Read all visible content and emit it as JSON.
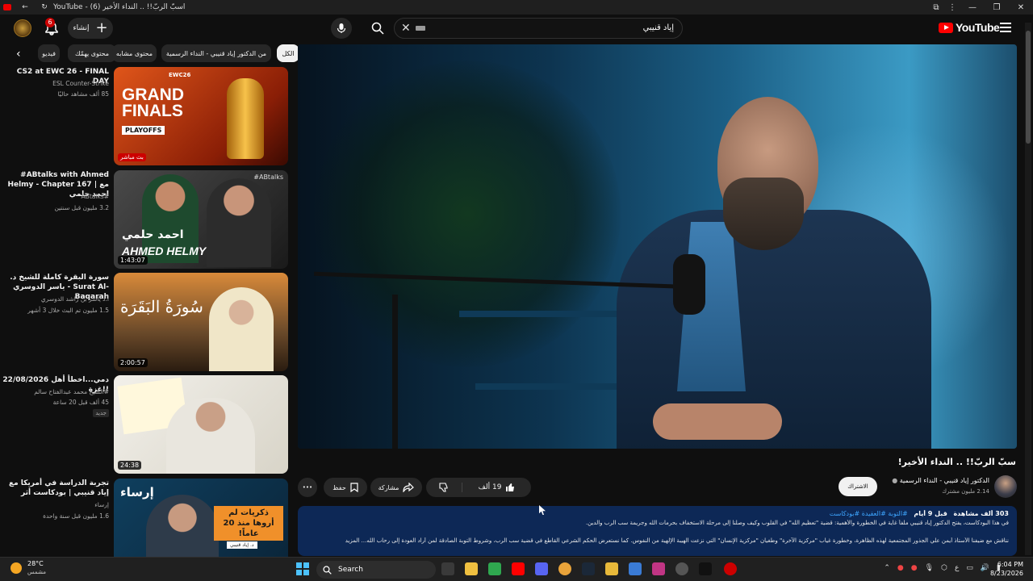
{
  "browser": {
    "tab_title": "YouTube - اسبّ الربّ!! .. النداء الأخير (6)"
  },
  "header": {
    "notif_count": "6",
    "create_label": "إنشاء",
    "search_query": "إياد قنيبي",
    "logo_text": "YouTube"
  },
  "chips": {
    "items": [
      "الكل",
      "من الدكتور إياد قنيبي - النداء الرسمية",
      "محتوى مشابه",
      "محتوى يهمّك",
      "فيديو"
    ]
  },
  "recommendations": [
    {
      "title": "CS2 at EWC 26 - FINAL DAY",
      "channel": "ESL Counter-Strike",
      "meta": "85 ألف مشاهد حاليًا",
      "badge": "بث مباشر",
      "thumb_text_1": "GRAND",
      "thumb_text_2": "FINALS",
      "thumb_text_3": "PLAYOFFS",
      "thumb_text_4": "EWC26"
    },
    {
      "title": "#ABtalks with Ahmed Helmy - Chapter 167 | مع احمد حلمي",
      "channel": "#ABtalks",
      "meta": "3.2 مليون  قبل سنتين",
      "duration": "1:43:07",
      "thumb_text_1": "احمد حلمي",
      "thumb_text_2": "AHMED HELMY",
      "thumb_text_3": "#ABtalks"
    },
    {
      "title": "سورة البقرة كاملة للشيخ د. ياسر الدوسري - Surat Al-Baqarah",
      "channel": "أ.د ياسر بن راشد الدوسري",
      "meta": "1.5 مليون  تم البث خلال 3 أشهر",
      "duration": "2:00:57",
      "thumb_text_1": "سُورَةُ البَقَرَة"
    },
    {
      "title": "22/08/2026 دمي...اخطأ أهل غزة!!",
      "channel": "#الشيخ محمد عبدالفتاح سالم",
      "meta": "45 ألف  قبل 20 ساعة",
      "badge": "جديد",
      "duration": "24:38"
    },
    {
      "title": "تجربة الدراسة في أمريكا مع إياد قنيبي | بودكاست أثر",
      "channel": "إرساء",
      "meta": "1.6 مليون  قبل سنة واحدة",
      "thumb_text_1": "إرساء",
      "thumb_text_2": "ذكريات لم أروها منذ 20 عاماً!",
      "thumb_text_3": "د. إياد قنيبي"
    }
  ],
  "video": {
    "title": "سبّ الربّ!! .. النداء الأخير!",
    "channel_name": "الدكتور إياد قنيبي - النداء الرسمية",
    "subscribers": "2.14 مليون مشترك",
    "subscribe_label": "الاشتراك",
    "likes": "19 ألف",
    "share_label": "مشاركة",
    "save_label": "حفظ",
    "more_label": "•••"
  },
  "description": {
    "views": "303 ألف مشاهدة",
    "date": "قبل 9 أيام",
    "tags": "#التوبة #العقيدة #بودكاست",
    "line2": "في هذا البودكاست، يفتح الدكتور إياد قنيبي ملفاً غاية في الخطورة والأهمية: قضية \"تعظيم الله\" في القلوب وكيف وصلنا إلى مرحلة الاستخفاف بحرمات الله وجريمة سب الرب والدين.",
    "line3": "نناقش مع ضيفنا الأستاذ أيمن علي الجذور المجتمعية لهذه الظاهرة، وخطورة غياب \"مركزية الآخرة\" وطغيان \"مركزية الإنسان\" التي نزعت الهيبة الإلهية من النفوس. كما نستعرض الحكم الشرعي القاطع في قضية سب الرب، وشروط التوبة الصادقة لمن أراد العودة إلى رحاب الله... المزيد"
  },
  "taskbar": {
    "weather_temp": "28°C",
    "weather_desc": "مشمس",
    "search_label": "Search",
    "time": "6:04 PM",
    "date": "8/23/2026",
    "lang": "ع"
  },
  "colors": {
    "brand_red": "#ff0000",
    "description_bg": "#0d2856",
    "link_blue": "#3ea6ff"
  }
}
